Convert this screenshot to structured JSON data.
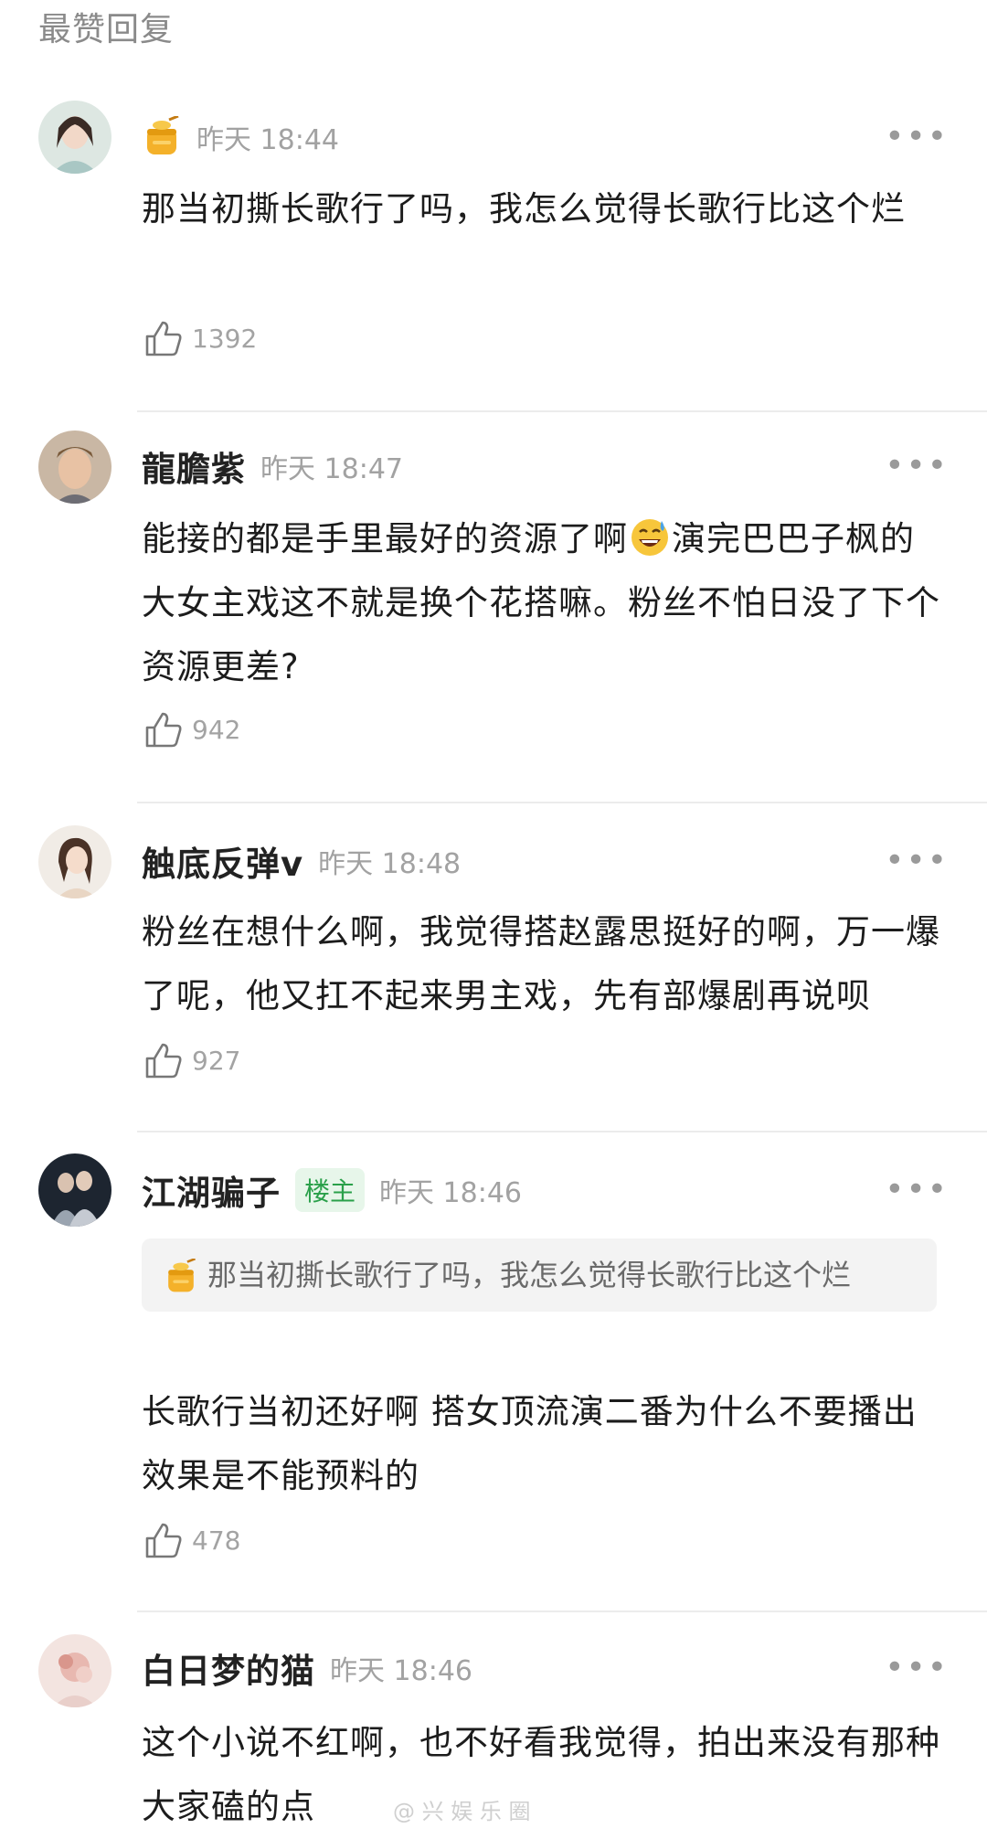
{
  "section_title": "最赞回复",
  "comments": [
    {
      "username": "",
      "time": "昨天 18:44",
      "text": "那当初撕长歌行了吗，我怎么觉得长歌行比这个烂",
      "likes": "1392",
      "more": "•••"
    },
    {
      "username": "龍膽紫",
      "time": "昨天 18:47",
      "text_before_emoji": "能接的都是手里最好的资源了啊",
      "text_after_emoji": "演完巴巴子枫的大女主戏这不就是换个花搭嘛。粉丝不怕日没了下个资源更差?",
      "likes": "942",
      "more": "•••"
    },
    {
      "username": "触底反弹v",
      "time": "昨天 18:48",
      "text": "粉丝在想什么啊，我觉得搭赵露思挺好的啊，万一爆了呢，他又扛不起来男主戏，先有部爆剧再说呗",
      "likes": "927",
      "more": "•••"
    },
    {
      "username": "江湖骗子",
      "op_badge": "楼主",
      "time": "昨天 18:46",
      "quote": "那当初撕长歌行了吗，我怎么觉得长歌行比这个烂",
      "text": "长歌行当初还好啊 搭女顶流演二番为什么不要播出效果是不能预料的",
      "likes": "478",
      "more": "•••"
    },
    {
      "username": "白日梦的猫",
      "time": "昨天 18:46",
      "text": "这个小说不红啊，也不好看我觉得，拍出来没有那种大家磕的点",
      "more": "•••"
    }
  ],
  "watermark": "@ 兴 娱 乐 圈"
}
